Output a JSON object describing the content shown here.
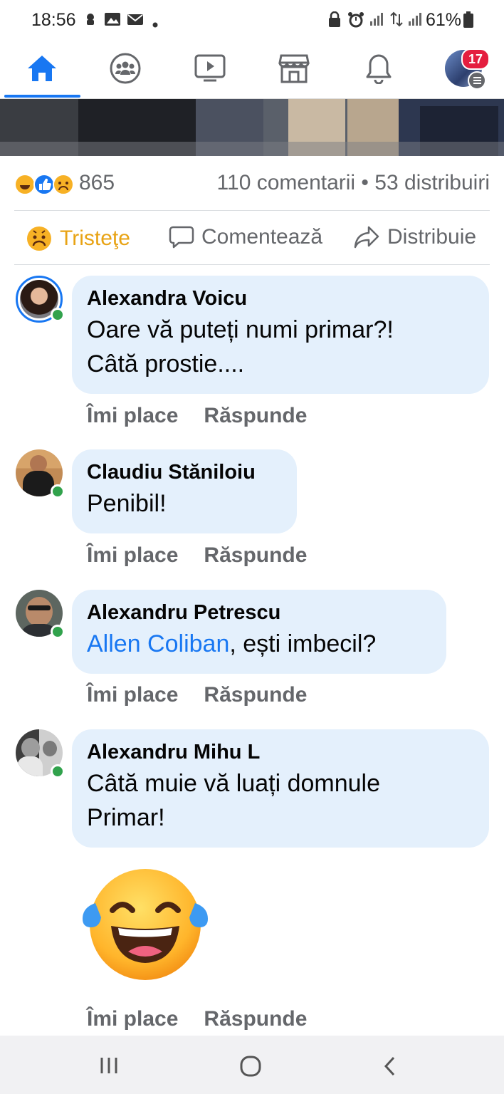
{
  "status_bar": {
    "time": "18:56",
    "battery": "61%"
  },
  "nav": {
    "tabs": [
      "home",
      "groups",
      "watch",
      "marketplace",
      "notifications",
      "menu"
    ],
    "menu_badge": "17",
    "accent": "#1877f2"
  },
  "post_stats": {
    "reaction_count": "865",
    "comments_shares": "110 comentarii • 53 distribuiri"
  },
  "actions": {
    "react_label": "Tristeţe",
    "comment_label": "Comentează",
    "share_label": "Distribuie"
  },
  "comments": [
    {
      "author": "Alexandra Voicu",
      "text_line1": "Oare vă puteți numi primar?!",
      "text_line2": "Câtă prostie....",
      "like": "Îmi place",
      "reply": "Răspunde"
    },
    {
      "author": "Claudiu Stăniloiu",
      "text_line1": "Penibil!",
      "like": "Îmi place",
      "reply": "Răspunde"
    },
    {
      "author": "Alexandru Petrescu",
      "mention": "Allen Coliban",
      "text_line1": ", ești imbecil?",
      "like": "Îmi place",
      "reply": "Răspunde"
    },
    {
      "author": "Alexandru Mihu L",
      "text_line1": "Câtă muie vă luați domnule",
      "text_line2": "Primar!",
      "like": "Îmi place",
      "reply": "Răspunde"
    }
  ]
}
